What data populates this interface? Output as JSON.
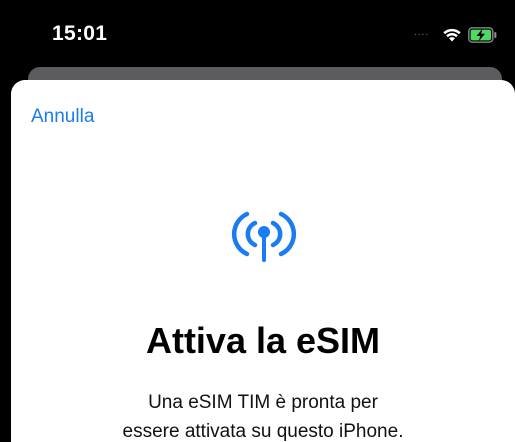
{
  "status_bar": {
    "time": "15:01",
    "signal_dots": "....",
    "wifi_icon": "wifi-icon",
    "battery_icon": "battery-charging-icon"
  },
  "sheet": {
    "cancel_label": "Annulla",
    "icon": "antenna-signal-icon",
    "title": "Attiva la eSIM",
    "subtitle_line1": "Una eSIM TIM è pronta per",
    "subtitle_line2": "essere attivata su questo iPhone."
  },
  "colors": {
    "accent": "#1a7cf2",
    "battery_green": "#4cd964",
    "background": "#000000",
    "sheet": "#ffffff"
  }
}
